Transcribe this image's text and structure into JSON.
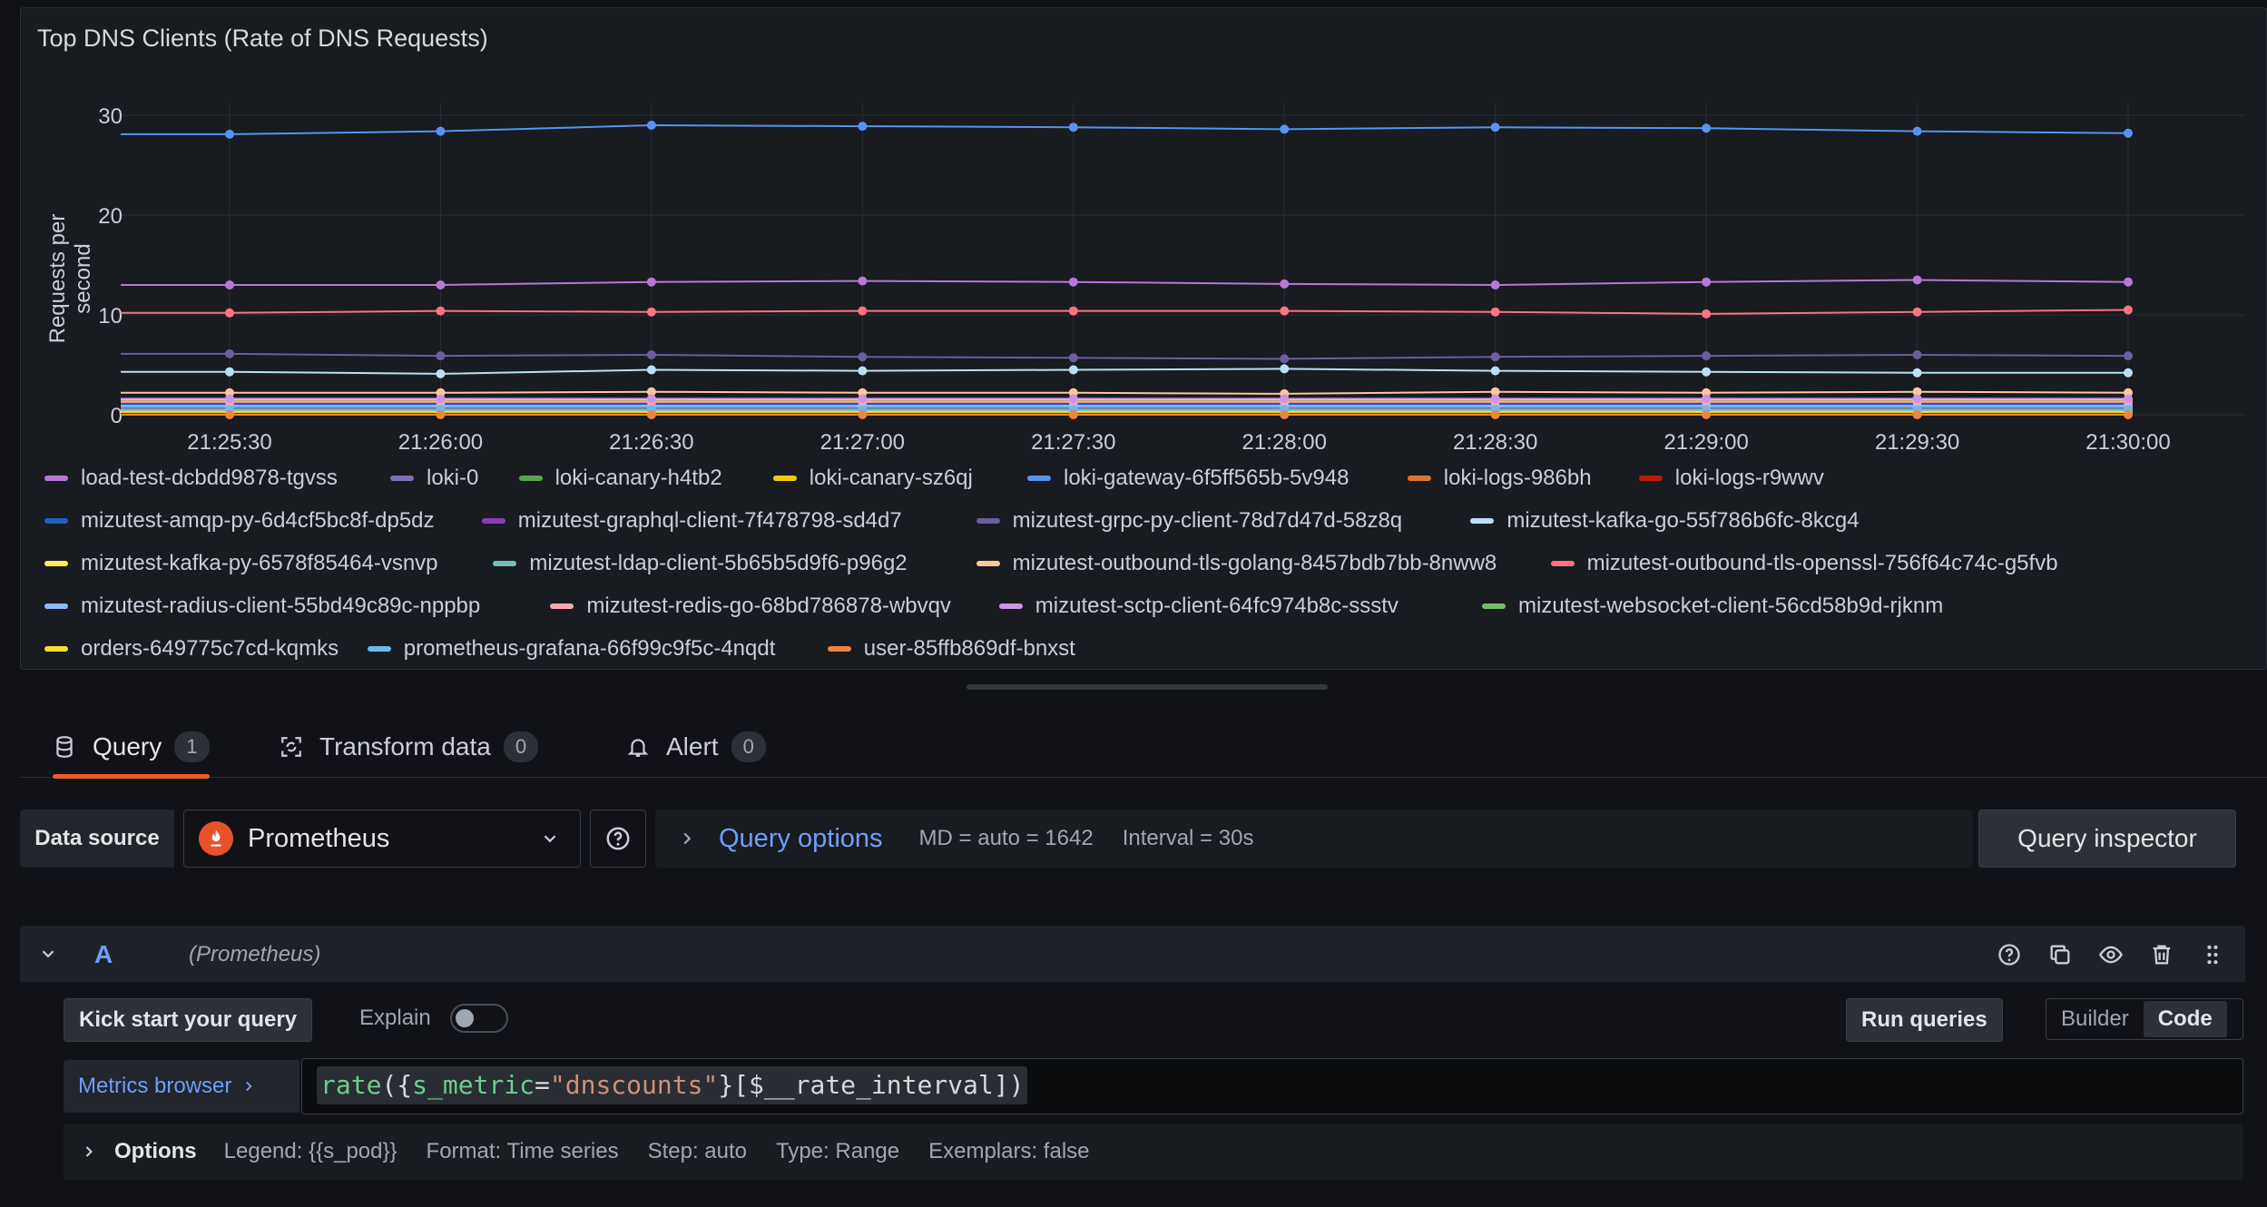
{
  "panel": {
    "title": "Top DNS Clients (Rate of DNS Requests)",
    "ylabel": "Requests per second"
  },
  "chart_data": {
    "type": "line",
    "title": "Top DNS Clients (Rate of DNS Requests)",
    "ylabel": "Requests per second",
    "xlabel": "",
    "ylim": [
      0,
      30
    ],
    "yticks": [
      0,
      10,
      20,
      30
    ],
    "grid": true,
    "legend_position": "bottom",
    "x": [
      "21:25:30",
      "21:26:00",
      "21:26:30",
      "21:27:00",
      "21:27:30",
      "21:28:00",
      "21:28:30",
      "21:29:00",
      "21:29:30",
      "21:30:00"
    ],
    "xticks": [
      "21:25:30",
      "21:26:00",
      "21:26:30",
      "21:27:00",
      "21:27:30",
      "21:28:00",
      "21:28:30",
      "21:29:00",
      "21:29:30",
      "21:30:00"
    ],
    "series": [
      {
        "name": "load-test-dcbdd9878-tgvss",
        "color": "#b877d9",
        "values": [
          13.0,
          13.0,
          13.3,
          13.4,
          13.3,
          13.1,
          13.0,
          13.3,
          13.5,
          13.3
        ]
      },
      {
        "name": "loki-0",
        "color": "#806eb7",
        "values": [
          0.6,
          0.6,
          0.6,
          0.6,
          0.6,
          0.6,
          0.6,
          0.6,
          0.6,
          0.6
        ]
      },
      {
        "name": "loki-canary-h4tb2",
        "color": "#56a64b",
        "values": [
          0.2,
          0.2,
          0.2,
          0.2,
          0.2,
          0.2,
          0.2,
          0.2,
          0.2,
          0.2
        ]
      },
      {
        "name": "loki-canary-sz6qj",
        "color": "#f2cc0c",
        "values": [
          0.2,
          0.2,
          0.2,
          0.2,
          0.2,
          0.2,
          0.2,
          0.2,
          0.2,
          0.2
        ]
      },
      {
        "name": "loki-gateway-6f5ff565b-5v948",
        "color": "#5794f2",
        "values": [
          28.1,
          28.4,
          29.0,
          28.9,
          28.8,
          28.6,
          28.8,
          28.7,
          28.4,
          28.2
        ]
      },
      {
        "name": "loki-logs-986bh",
        "color": "#e0752d",
        "values": [
          0.1,
          0.1,
          0.1,
          0.1,
          0.1,
          0.1,
          0.1,
          0.1,
          0.1,
          0.1
        ]
      },
      {
        "name": "loki-logs-r9wwv",
        "color": "#bf1b00",
        "values": [
          0.1,
          0.1,
          0.1,
          0.1,
          0.1,
          0.1,
          0.1,
          0.1,
          0.1,
          0.1
        ]
      },
      {
        "name": "mizutest-amqp-py-6d4cf5bc8f-dp5dz",
        "color": "#1f60c4",
        "values": [
          1.0,
          1.0,
          1.0,
          1.0,
          1.0,
          1.0,
          1.0,
          1.0,
          1.0,
          1.0
        ]
      },
      {
        "name": "mizutest-graphql-client-7f478798-sd4d7",
        "color": "#8f3bb8",
        "values": [
          1.2,
          1.2,
          1.2,
          1.2,
          1.2,
          1.2,
          1.2,
          1.2,
          1.2,
          1.2
        ]
      },
      {
        "name": "mizutest-grpc-py-client-78d7d47d-58z8q",
        "color": "#6d5e9e",
        "values": [
          6.1,
          5.9,
          6.0,
          5.8,
          5.7,
          5.6,
          5.8,
          5.9,
          6.0,
          5.9
        ]
      },
      {
        "name": "mizutest-kafka-go-55f786b6fc-8kcg4",
        "color": "#badff4",
        "values": [
          4.3,
          4.1,
          4.5,
          4.4,
          4.5,
          4.6,
          4.4,
          4.3,
          4.2,
          4.2
        ]
      },
      {
        "name": "mizutest-kafka-py-6578f85464-vsnvp",
        "color": "#ffee52",
        "values": [
          1.5,
          1.5,
          1.5,
          1.5,
          1.5,
          1.5,
          1.5,
          1.5,
          1.5,
          1.5
        ]
      },
      {
        "name": "mizutest-ldap-client-5b65b5d9f6-p96g2",
        "color": "#73bfb8",
        "values": [
          0.8,
          0.8,
          0.8,
          0.8,
          0.8,
          0.8,
          0.8,
          0.8,
          0.8,
          0.8
        ]
      },
      {
        "name": "mizutest-outbound-tls-golang-8457bdb7bb-8nww8",
        "color": "#fac898",
        "values": [
          2.2,
          2.2,
          2.3,
          2.2,
          2.2,
          2.1,
          2.3,
          2.2,
          2.3,
          2.2
        ]
      },
      {
        "name": "mizutest-outbound-tls-openssl-756f64c74c-g5fvb",
        "color": "#ff7383",
        "values": [
          10.2,
          10.4,
          10.3,
          10.4,
          10.4,
          10.4,
          10.3,
          10.1,
          10.3,
          10.5
        ]
      },
      {
        "name": "mizutest-radius-client-55bd49c89c-nppbp",
        "color": "#8ab8ff",
        "values": [
          0.9,
          0.9,
          0.9,
          0.9,
          0.9,
          0.9,
          0.9,
          0.9,
          0.9,
          0.9
        ]
      },
      {
        "name": "mizutest-redis-go-68bd786878-wbvqv",
        "color": "#ffa6b0",
        "values": [
          1.3,
          1.3,
          1.3,
          1.3,
          1.3,
          1.3,
          1.3,
          1.3,
          1.3,
          1.3
        ]
      },
      {
        "name": "mizutest-sctp-client-64fc974b8c-ssstv",
        "color": "#ca95e5",
        "values": [
          1.6,
          1.6,
          1.6,
          1.6,
          1.6,
          1.6,
          1.6,
          1.6,
          1.6,
          1.6
        ]
      },
      {
        "name": "mizutest-websocket-client-56cd58b9d-rjknm",
        "color": "#73bf69",
        "values": [
          0.4,
          0.4,
          0.4,
          0.4,
          0.4,
          0.4,
          0.4,
          0.4,
          0.4,
          0.4
        ]
      },
      {
        "name": "orders-649775c7cd-kqmks",
        "color": "#fade2a",
        "values": [
          0.3,
          0.3,
          0.3,
          0.3,
          0.3,
          0.3,
          0.3,
          0.3,
          0.3,
          0.3
        ]
      },
      {
        "name": "prometheus-grafana-66f99c9f5c-4nqdt",
        "color": "#6ab9e8",
        "values": [
          0.5,
          0.5,
          0.5,
          0.5,
          0.5,
          0.5,
          0.5,
          0.5,
          0.5,
          0.5
        ]
      },
      {
        "name": "user-85ffb869df-bnxst",
        "color": "#ef843c",
        "values": [
          0.0,
          0.0,
          0.0,
          0.0,
          0.0,
          0.0,
          0.0,
          0.0,
          0.0,
          0.0
        ]
      }
    ]
  },
  "tabs": [
    {
      "label": "Query",
      "count": "1",
      "icon": "database-icon"
    },
    {
      "label": "Transform data",
      "count": "0",
      "icon": "transform-icon"
    },
    {
      "label": "Alert",
      "count": "0",
      "icon": "bell-icon"
    }
  ],
  "datasource": {
    "label": "Data source",
    "selected": "Prometheus",
    "query_options_label": "Query options",
    "md": "MD = auto = 1642",
    "interval": "Interval = 30s",
    "inspector_label": "Query inspector"
  },
  "query_row": {
    "ref_id": "A",
    "ds_name": "(Prometheus)",
    "kick_start": "Kick start your query",
    "explain": "Explain",
    "run_queries": "Run queries",
    "mode_builder": "Builder",
    "mode_code": "Code",
    "metrics_browser": "Metrics browser",
    "code": {
      "fn": "rate",
      "open": "({",
      "label": "s_metric",
      "eq": "=",
      "value": "\"dnscounts\"",
      "rest": "}[$__rate_interval])"
    },
    "options": {
      "title": "Options",
      "legend": "Legend: {{s_pod}}",
      "format": "Format: Time series",
      "step": "Step: auto",
      "type": "Type: Range",
      "exemplars": "Exemplars: false"
    }
  },
  "colors": {
    "accent": "#f05a28",
    "link": "#6e9fff",
    "prometheus": "#e6522c"
  }
}
